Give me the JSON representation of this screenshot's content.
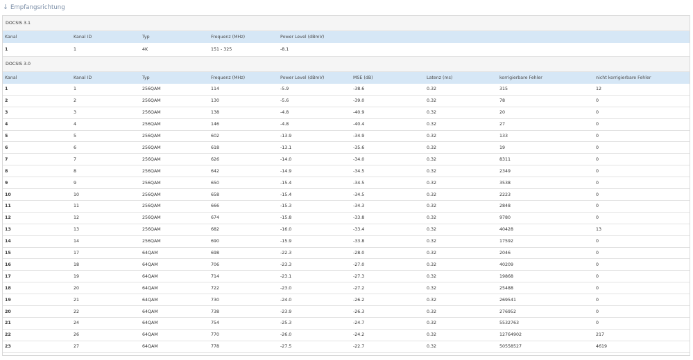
{
  "section": {
    "arrow": "↓",
    "title": "Empfangsrichtung"
  },
  "docsis31": {
    "title": "DOCSIS 3.1",
    "headers": [
      "Kanal",
      "Kanal ID",
      "Typ",
      "Frequenz (MHz)",
      "Power Level (dBmV)"
    ],
    "rows": [
      [
        "1",
        "1",
        "4K",
        "151 - 325",
        "-8.1"
      ]
    ]
  },
  "docsis30": {
    "title": "DOCSIS 3.0",
    "headers": [
      "Kanal",
      "Kanal ID",
      "Typ",
      "Frequenz (MHz)",
      "Power Level (dBmV)",
      "MSE (dB)",
      "Latenz (ms)",
      "korrigierbare Fehler",
      "nicht korrigierbare Fehler"
    ],
    "rows": [
      [
        "1",
        "1",
        "256QAM",
        "114",
        "-5.9",
        "-38.6",
        "0.32",
        "315",
        "12"
      ],
      [
        "2",
        "2",
        "256QAM",
        "130",
        "-5.6",
        "-39.0",
        "0.32",
        "78",
        "0"
      ],
      [
        "3",
        "3",
        "256QAM",
        "138",
        "-4.8",
        "-40.9",
        "0.32",
        "20",
        "0"
      ],
      [
        "4",
        "4",
        "256QAM",
        "146",
        "-4.8",
        "-40.4",
        "0.32",
        "27",
        "0"
      ],
      [
        "5",
        "5",
        "256QAM",
        "602",
        "-13.9",
        "-34.9",
        "0.32",
        "133",
        "0"
      ],
      [
        "6",
        "6",
        "256QAM",
        "618",
        "-13.1",
        "-35.6",
        "0.32",
        "19",
        "0"
      ],
      [
        "7",
        "7",
        "256QAM",
        "626",
        "-14.0",
        "-34.0",
        "0.32",
        "8311",
        "0"
      ],
      [
        "8",
        "8",
        "256QAM",
        "642",
        "-14.9",
        "-34.5",
        "0.32",
        "2349",
        "0"
      ],
      [
        "9",
        "9",
        "256QAM",
        "650",
        "-15.4",
        "-34.5",
        "0.32",
        "3538",
        "0"
      ],
      [
        "10",
        "10",
        "256QAM",
        "658",
        "-15.4",
        "-34.5",
        "0.32",
        "2223",
        "0"
      ],
      [
        "11",
        "11",
        "256QAM",
        "666",
        "-15.3",
        "-34.3",
        "0.32",
        "2848",
        "0"
      ],
      [
        "12",
        "12",
        "256QAM",
        "674",
        "-15.8",
        "-33.8",
        "0.32",
        "9780",
        "0"
      ],
      [
        "13",
        "13",
        "256QAM",
        "682",
        "-16.0",
        "-33.4",
        "0.32",
        "40428",
        "13"
      ],
      [
        "14",
        "14",
        "256QAM",
        "690",
        "-15.9",
        "-33.8",
        "0.32",
        "17592",
        "0"
      ],
      [
        "15",
        "17",
        "64QAM",
        "698",
        "-22.3",
        "-28.0",
        "0.32",
        "2046",
        "0"
      ],
      [
        "16",
        "18",
        "64QAM",
        "706",
        "-23.3",
        "-27.0",
        "0.32",
        "40209",
        "0"
      ],
      [
        "17",
        "19",
        "64QAM",
        "714",
        "-23.1",
        "-27.3",
        "0.32",
        "19868",
        "0"
      ],
      [
        "18",
        "20",
        "64QAM",
        "722",
        "-23.0",
        "-27.2",
        "0.32",
        "25488",
        "0"
      ],
      [
        "19",
        "21",
        "64QAM",
        "730",
        "-24.0",
        "-26.2",
        "0.32",
        "269541",
        "0"
      ],
      [
        "20",
        "22",
        "64QAM",
        "738",
        "-23.9",
        "-26.3",
        "0.32",
        "276952",
        "0"
      ],
      [
        "21",
        "24",
        "64QAM",
        "754",
        "-25.3",
        "-24.7",
        "0.32",
        "5532763",
        "0"
      ],
      [
        "22",
        "26",
        "64QAM",
        "770",
        "-26.0",
        "-24.2",
        "0.32",
        "12764902",
        "217"
      ],
      [
        "23",
        "27",
        "64QAM",
        "778",
        "-27.5",
        "-22.7",
        "0.32",
        "50558527",
        "4619"
      ]
    ]
  }
}
